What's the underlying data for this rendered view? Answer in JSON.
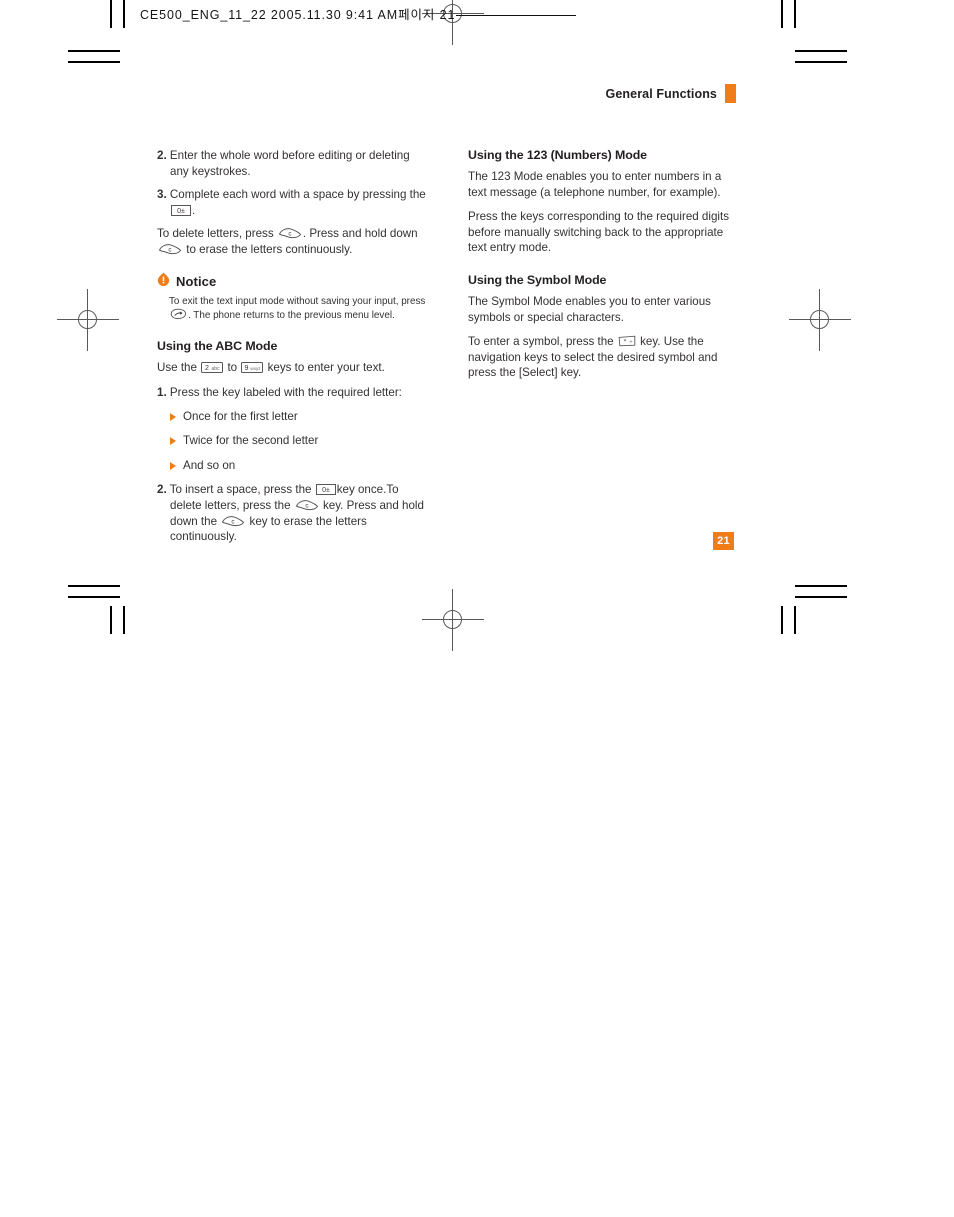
{
  "scan_header": {
    "text": "CE500_ENG_11_22  2005.11.30  9:41 AM페이지 21"
  },
  "running_head": {
    "title": "General Functions",
    "tab_color": "#f07d1a"
  },
  "page_number": {
    "value": "21",
    "background": "#f07d1a",
    "text_color": "#ffffff"
  },
  "colors": {
    "accent": "#f07d1a",
    "body_text": "#353132",
    "heading_text": "#231f20"
  },
  "left_column": {
    "step2": {
      "num": "2.",
      "text": "Enter the whole word before editing or deleting any keystrokes."
    },
    "step3": {
      "num": "3.",
      "text_before": "Complete each word with a space by pressing the",
      "key_icon": "key-0-space",
      "key_label": "0",
      "text_after": "."
    },
    "delete_para": {
      "part1": "To delete letters, press",
      "key_icon_1": "key-clear-c",
      "part2": ". Press and hold down",
      "key_icon_2": "key-clear-c",
      "part3": "to erase the letters continuously."
    },
    "notice": {
      "icon": "notice-exclamation-icon",
      "title": "Notice",
      "text_before": "To exit the text input mode without saving your input, press",
      "key_icon": "key-end-call",
      "text_after": ". The phone returns to the previous menu level."
    },
    "abc_section": {
      "heading": "Using the ABC Mode",
      "intro_before": "Use the",
      "key_icon_1": "key-2-abc",
      "key_label_1": "2abc",
      "intro_middle": "to",
      "key_icon_2": "key-9-wxyz",
      "key_label_2": "9wxyz",
      "intro_after": "keys to enter your text.",
      "step1": {
        "num": "1.",
        "text": "Press the key labeled with the required letter:"
      },
      "bullets": [
        "Once for the first letter",
        "Twice for the second letter",
        "And so on"
      ],
      "step2": {
        "num": "2.",
        "part1": "To insert a space, press the",
        "key_icon_1": "key-0-space",
        "part2": "key once.To delete letters, press the",
        "key_icon_2": "key-clear-c",
        "part3": "key. Press and hold down the",
        "key_icon_3": "key-clear-c",
        "part4": "key to erase the letters continuously."
      }
    }
  },
  "right_column": {
    "numbers_section": {
      "heading": "Using the 123 (Numbers) Mode",
      "para1": "The 123 Mode enables you to enter numbers in a text message (a telephone number, for example).",
      "para2": "Press the keys corresponding to the required digits before manually switching back to the appropriate text entry mode."
    },
    "symbol_section": {
      "heading": "Using the Symbol Mode",
      "para1": "The Symbol Mode enables you to enter various symbols or special characters.",
      "para2_before": "To enter a symbol, press the",
      "key_icon": "key-symbol-star",
      "para2_after": "key. Use the navigation keys to select the desired symbol and press the [Select] key."
    }
  }
}
